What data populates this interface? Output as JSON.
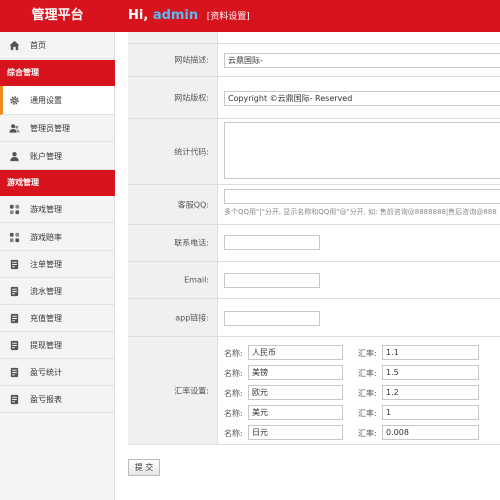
{
  "header": {
    "brand": "管理平台",
    "greeting": "Hi,",
    "username": "admin",
    "profile_link": "[资料设置]"
  },
  "sidebar": {
    "home": "首页",
    "group1": "综合管理",
    "group1_items": [
      "通用设置",
      "管理员管理",
      "账户管理"
    ],
    "group2": "游戏管理",
    "group2_items": [
      "游戏管理",
      "游戏赔率",
      "注单管理",
      "流水管理",
      "充值管理",
      "提现管理",
      "盈亏统计",
      "盈亏报表"
    ]
  },
  "form": {
    "site_desc_label": "网站描述:",
    "site_desc_value": "云鼎国际-",
    "copyright_label": "网站版权:",
    "copyright_value": "Copyright ©云鼎国际- Reserved",
    "stats_label": "统计代码:",
    "stats_value": "",
    "qq_label": "客服QQ:",
    "qq_value": "",
    "qq_hint": "多个QQ用\"|\"分开, 显示名称和QQ用\"@\"分开, 如: 售前咨询@8888888|售后咨询@888",
    "phone_label": "联系电话:",
    "phone_value": "",
    "email_label": "Email:",
    "email_value": "",
    "app_label": "app链接:",
    "app_value": "",
    "rates_label": "汇率设置:",
    "name_prefix": "名称:",
    "rate_prefix": "汇率:",
    "rates": [
      {
        "name": "人民币",
        "rate": "1.1"
      },
      {
        "name": "美镑",
        "rate": "1.5"
      },
      {
        "name": "欧元",
        "rate": "1.2"
      },
      {
        "name": "美元",
        "rate": "1"
      },
      {
        "name": "日元",
        "rate": "0.008"
      }
    ],
    "submit": "提 交"
  },
  "colors": {
    "header_red": "#d7141e",
    "active_accent": "#f08b1d",
    "username_blue": "#5ab8f5"
  }
}
